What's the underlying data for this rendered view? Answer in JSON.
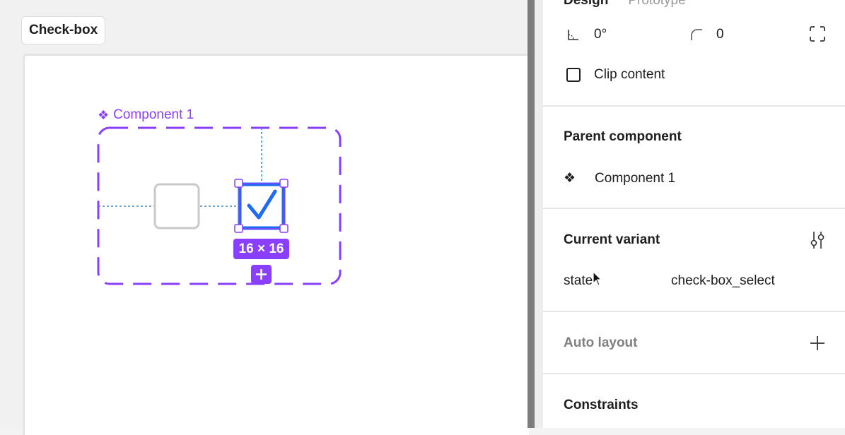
{
  "canvas": {
    "frame_label": "Check-box",
    "component_name": "Component 1",
    "size_badge": "16 × 16"
  },
  "panel": {
    "tabs": [
      {
        "label": "Design",
        "active": true
      },
      {
        "label": "Prototype",
        "active": false
      }
    ],
    "rotation": "0°",
    "corner_radius": "0",
    "clip_content_label": "Clip content",
    "clip_content_checked": false,
    "parent_component": {
      "title": "Parent component",
      "name": "Component 1"
    },
    "current_variant": {
      "title": "Current variant",
      "property_name": "state",
      "property_value": "check-box_select"
    },
    "auto_layout_title": "Auto layout",
    "constraints_title": "Constraints"
  },
  "colors": {
    "component_purple": "#8a3ffc",
    "selection_blue": "#1d6bf3",
    "divider": "#e6e6e6"
  }
}
